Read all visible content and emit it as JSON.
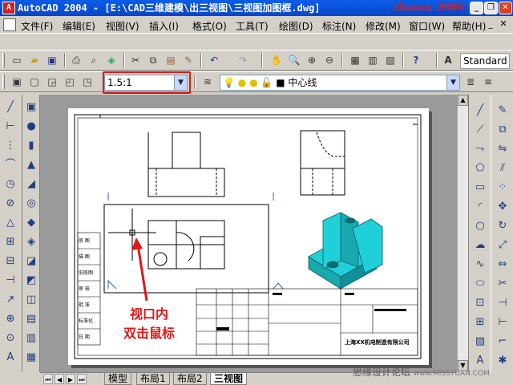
{
  "window": {
    "title": "AutoCAD 2004 - [E:\\CAD三维建模\\出三视图\\三视图加图框.dwg]",
    "watermark": "zhaozx 2000",
    "minimize": "_",
    "restore": "❐",
    "close": "✕"
  },
  "menubar": {
    "items": [
      "文件(F)",
      "编辑(E)",
      "视图(V)",
      "插入(I)",
      "格式(O)",
      "工具(T)",
      "绘图(D)",
      "标注(N)",
      "修改(M)",
      "窗口(W)",
      "帮助(H)"
    ],
    "mdi_minimize": "_",
    "mdi_restore": "❐",
    "mdi_close": "✕"
  },
  "standard_toolbar": {
    "textstyle_value": "Standard"
  },
  "viewport_toolbar": {
    "scale_value": "1.5:1",
    "layer_value": "中心线",
    "dropdown_arrow": "▼"
  },
  "layout_tabs": {
    "tabs": [
      "模型",
      "布局1",
      "布局2",
      "三视图"
    ],
    "active_index": 3
  },
  "drawing": {
    "title_block_company": "上海XX机电制造有限公司",
    "side_labels": [
      "底 图",
      "描 图",
      "旧底图",
      "审 核",
      "批 准",
      "标准化",
      "日 期"
    ]
  },
  "annotation": {
    "line1": "视口内",
    "line2": "双击鼠标"
  },
  "site_watermark": {
    "text": "思缘设计论坛",
    "url": "www.MISSYUAN.COM"
  },
  "colors": {
    "titlebar": "#0a5de8",
    "annotation_red": "#e01818",
    "model_cyan": "#20d0d8"
  }
}
